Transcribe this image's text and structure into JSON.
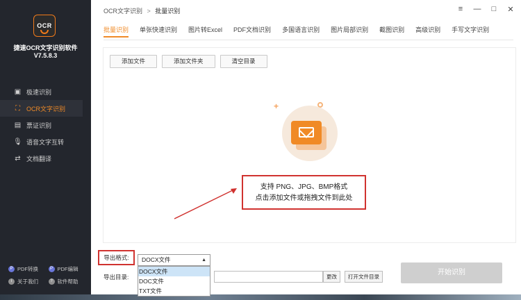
{
  "app": {
    "logo_text": "OCR",
    "name": "捷速OCR文字识别软件",
    "version": "V7.5.8.3"
  },
  "sidebar": {
    "items": [
      {
        "label": "极速识别",
        "icon": "image-icon",
        "active": false
      },
      {
        "label": "OCR文字识别",
        "icon": "scan-icon",
        "active": true
      },
      {
        "label": "票证识别",
        "icon": "ticket-icon",
        "active": false
      },
      {
        "label": "语音文字互转",
        "icon": "microphone-icon",
        "active": false
      },
      {
        "label": "文档翻译",
        "icon": "translate-icon",
        "active": false
      }
    ],
    "bottom_links": [
      {
        "label": "PDF转换",
        "icon": "pdf-convert-icon"
      },
      {
        "label": "PDF编辑",
        "icon": "pdf-edit-icon"
      },
      {
        "label": "关于我们",
        "icon": "info-icon"
      },
      {
        "label": "软件帮助",
        "icon": "help-icon"
      }
    ]
  },
  "breadcrumb": {
    "parent": "OCR文字识别",
    "separator": ">",
    "current": "批量识别"
  },
  "window_controls": {
    "menu": "≡",
    "minimize": "—",
    "maximize": "□",
    "close": "✕"
  },
  "tabs": [
    {
      "label": "批量识别",
      "active": true
    },
    {
      "label": "单张快速识别",
      "active": false
    },
    {
      "label": "图片转Excel",
      "active": false
    },
    {
      "label": "PDF文档识别",
      "active": false
    },
    {
      "label": "多国语言识别",
      "active": false
    },
    {
      "label": "图片局部识别",
      "active": false
    },
    {
      "label": "截图识别",
      "active": false
    },
    {
      "label": "高级识别",
      "active": false
    },
    {
      "label": "手写文字识别",
      "active": false
    }
  ],
  "toolbar": {
    "add_file": "添加文件",
    "add_folder": "添加文件夹",
    "clear_list": "清空目录"
  },
  "drop_area": {
    "line1": "支持 PNG、JPG、BMP格式",
    "line2": "点击添加文件或拖拽文件到此处"
  },
  "export": {
    "format_label": "导出格式:",
    "selected_format": "DOCX文件",
    "options": [
      "DOCX文件",
      "DOC文件",
      "TXT文件"
    ],
    "dir_label": "导出目录:",
    "dir_value": "",
    "change_button": "更改",
    "open_folder_button": "打开文件目录",
    "start_button": "开始识别"
  },
  "colors": {
    "accent": "#f08a26",
    "sidebar_bg": "#23262d",
    "highlight_red": "#d0322f"
  }
}
